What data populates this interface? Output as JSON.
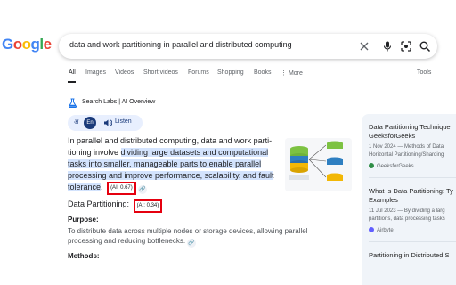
{
  "logo": {
    "letters": [
      "G",
      "o",
      "o",
      "g",
      "l",
      "e"
    ],
    "colors": [
      "#4285F4",
      "#EA4335",
      "#FBBC05",
      "#4285F4",
      "#34A853",
      "#EA4335"
    ]
  },
  "search": {
    "query": "data and work partitioning in parallel and distributed computing"
  },
  "icons": {
    "clear": "close-icon",
    "voice": "microphone-icon",
    "lens": "lens-icon",
    "search": "search-icon"
  },
  "tabs": [
    "All",
    "Images",
    "Videos",
    "Short videos",
    "Forums",
    "Shopping",
    "Books",
    "⋮ More"
  ],
  "tools_label": "Tools",
  "ai_overview": {
    "title": "Search Labs | AI Overview",
    "lang_icon": "अ",
    "lang_chip": "En",
    "listen_label": "Listen",
    "para_plain": "In parallel and distributed computing, data and work parti-tioning involve ",
    "para_highlight": "dividing large datasets and computational tasks into smaller, manageable parts to enable parallel processing and improve performance, scalability, and fault tolerance",
    "para_end": ".",
    "badge_1": "(AI: 0.67)",
    "subheading": "Data Partitioning:",
    "badge_2": "(AI: 0.34)",
    "purpose_label": "Purpose:",
    "purpose_text": "To distribute data across multiple nodes or storage devices, allowing parallel processing and reducing bottlenecks.",
    "methods_label": "Methods:"
  },
  "sources": [
    {
      "title_1": "Data Partitioning Technique",
      "title_2": "GeeksforGeeks",
      "meta_1": "1 Nov 2024 — Methods of Data",
      "meta_2": "Horizontal Partitioning/Sharding",
      "site": "GeeksforGeeks",
      "color": "#2f8d46"
    },
    {
      "title_1": "What Is Data Partitioning: Ty",
      "title_2": "Examples",
      "meta_1": "11 Jul 2023 — By dividing a larg",
      "meta_2": "partitions, data processing tasks",
      "site": "Airbyte",
      "color": "#615eff"
    },
    {
      "title_1": "Partitioning in Distributed S"
    }
  ]
}
